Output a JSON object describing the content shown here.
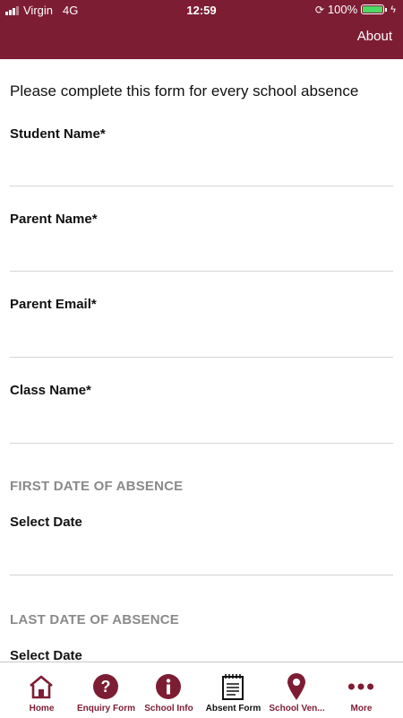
{
  "status_bar": {
    "carrier": "Virgin",
    "network": "4G",
    "time": "12:59",
    "battery": "100%"
  },
  "header": {
    "about_label": "About"
  },
  "form": {
    "intro": "Please complete this form for every school absence",
    "student_name_label": "Student Name*",
    "parent_name_label": "Parent Name*",
    "parent_email_label": "Parent Email*",
    "class_name_label": "Class Name*",
    "first_date_section": "FIRST DATE OF ABSENCE",
    "first_date_label": "Select Date",
    "last_date_section": "LAST DATE OF ABSENCE",
    "last_date_label": "Select Date"
  },
  "tabs": [
    {
      "label": "Home",
      "icon": "home-icon"
    },
    {
      "label": "Enquiry Form",
      "icon": "question-icon"
    },
    {
      "label": "School Info",
      "icon": "info-icon"
    },
    {
      "label": "Absent Form",
      "icon": "notepad-icon"
    },
    {
      "label": "School Ven...",
      "icon": "location-pin-icon"
    },
    {
      "label": "More",
      "icon": "more-icon"
    }
  ],
  "colors": {
    "brand": "#7d1d33",
    "battery": "#4cd964",
    "section_text": "#8a8a8a"
  }
}
